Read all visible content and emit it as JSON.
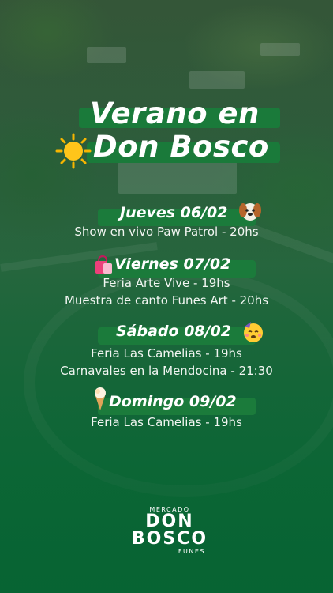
{
  "title": {
    "line1": "Verano en",
    "line2": "Don Bosco"
  },
  "days": [
    {
      "title": "Jueves 06/02",
      "emoji": "dog-face-icon",
      "events": [
        "Show en vivo Paw Patrol - 20hs"
      ]
    },
    {
      "title": "Viernes 07/02",
      "emoji": "shopping-bags-icon",
      "events": [
        "Feria Arte Vive - 19hs",
        "Muestra de canto Funes Art - 20hs"
      ]
    },
    {
      "title": "Sábado 08/02",
      "emoji": "party-face-icon",
      "events": [
        "Feria Las Camelias - 19hs",
        "Carnavales en la Mendocina - 21:30"
      ]
    },
    {
      "title": "Domingo 09/02",
      "emoji": "ice-cream-icon",
      "events": [
        "Feria Las Camelias - 19hs"
      ]
    }
  ],
  "logo": {
    "top": "MERCADO",
    "line1": "DON",
    "line2": "BOSCO",
    "bottom": "FUNES"
  },
  "colors": {
    "band": "#1b7b3b",
    "text": "#ffffff",
    "background_bottom": "#0d6537"
  }
}
